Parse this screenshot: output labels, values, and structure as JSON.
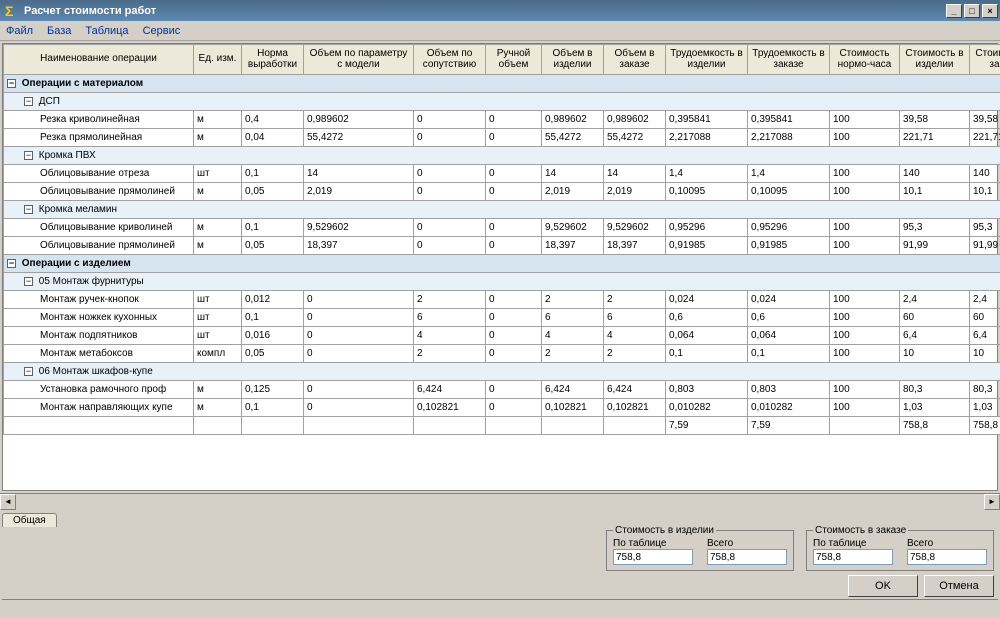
{
  "window": {
    "title": "Расчет стоимости работ"
  },
  "menu": {
    "file": "Файл",
    "base": "База",
    "table": "Таблица",
    "service": "Сервис"
  },
  "columns": [
    "Наименование операции",
    "Ед. изм.",
    "Норма выработки",
    "Объем по параметру с модели",
    "Объем по сопутствию",
    "Ручной объем",
    "Объем в изделии",
    "Объем в заказе",
    "Трудоемкость в изделии",
    "Трудоемкость в заказе",
    "Стоимость нормо-часа",
    "Стоимость в изделии",
    "Стоимость в заказе"
  ],
  "groups": [
    {
      "label": "Операции с материалом",
      "sub": [
        {
          "label": "ДСП",
          "rows": [
            {
              "name": "Резка криволинейная",
              "u": "м",
              "norm": "0,4",
              "p1": "0,989602",
              "p2": "0",
              "p3": "0",
              "v1": "0,989602",
              "v2": "0,989602",
              "t1": "0,395841",
              "t2": "0,395841",
              "c": "100",
              "s1": "39,58",
              "s2": "39,58"
            },
            {
              "name": "Резка прямолинейная",
              "u": "м",
              "norm": "0,04",
              "p1": "55,4272",
              "p2": "0",
              "p3": "0",
              "v1": "55,4272",
              "v2": "55,4272",
              "t1": "2,217088",
              "t2": "2,217088",
              "c": "100",
              "s1": "221,71",
              "s2": "221,71"
            }
          ]
        },
        {
          "label": "Кромка ПВХ",
          "rows": [
            {
              "name": "Облицовывание отреза",
              "u": "шт",
              "norm": "0,1",
              "p1": "14",
              "p2": "0",
              "p3": "0",
              "v1": "14",
              "v2": "14",
              "t1": "1,4",
              "t2": "1,4",
              "c": "100",
              "s1": "140",
              "s2": "140"
            },
            {
              "name": "Облицовывание прямолиней",
              "u": "м",
              "norm": "0,05",
              "p1": "2,019",
              "p2": "0",
              "p3": "0",
              "v1": "2,019",
              "v2": "2,019",
              "t1": "0,10095",
              "t2": "0,10095",
              "c": "100",
              "s1": "10,1",
              "s2": "10,1"
            }
          ]
        },
        {
          "label": "Кромка меламин",
          "rows": [
            {
              "name": "Облицовывание криволиней",
              "u": "м",
              "norm": "0,1",
              "p1": "9,529602",
              "p2": "0",
              "p3": "0",
              "v1": "9,529602",
              "v2": "9,529602",
              "t1": "0,95296",
              "t2": "0,95296",
              "c": "100",
              "s1": "95,3",
              "s2": "95,3"
            },
            {
              "name": "Облицовывание прямолиней",
              "u": "м",
              "norm": "0,05",
              "p1": "18,397",
              "p2": "0",
              "p3": "0",
              "v1": "18,397",
              "v2": "18,397",
              "t1": "0,91985",
              "t2": "0,91985",
              "c": "100",
              "s1": "91,99",
              "s2": "91,99"
            }
          ]
        }
      ]
    },
    {
      "label": "Операции с изделием",
      "sub": [
        {
          "label": "05 Монтаж фурнитуры",
          "rows": [
            {
              "name": "Монтаж ручек-кнопок",
              "u": "шт",
              "norm": "0,012",
              "p1": "0",
              "p2": "2",
              "p3": "0",
              "v1": "2",
              "v2": "2",
              "t1": "0,024",
              "t2": "0,024",
              "c": "100",
              "s1": "2,4",
              "s2": "2,4"
            },
            {
              "name": "Монтаж ножкек кухонных",
              "u": "шт",
              "norm": "0,1",
              "p1": "0",
              "p2": "6",
              "p3": "0",
              "v1": "6",
              "v2": "6",
              "t1": "0,6",
              "t2": "0,6",
              "c": "100",
              "s1": "60",
              "s2": "60"
            },
            {
              "name": "Монтаж подпятников",
              "u": "шт",
              "norm": "0,016",
              "p1": "0",
              "p2": "4",
              "p3": "0",
              "v1": "4",
              "v2": "4",
              "t1": "0,064",
              "t2": "0,064",
              "c": "100",
              "s1": "6,4",
              "s2": "6,4"
            },
            {
              "name": "Монтаж метабоксов",
              "u": "компл",
              "norm": "0,05",
              "p1": "0",
              "p2": "2",
              "p3": "0",
              "v1": "2",
              "v2": "2",
              "t1": "0,1",
              "t2": "0,1",
              "c": "100",
              "s1": "10",
              "s2": "10"
            }
          ]
        },
        {
          "label": "06 Монтаж шкафов-купе",
          "rows": [
            {
              "name": "Установка рамочного проф",
              "u": "м",
              "norm": "0,125",
              "p1": "0",
              "p2": "6,424",
              "p3": "0",
              "v1": "6,424",
              "v2": "6,424",
              "t1": "0,803",
              "t2": "0,803",
              "c": "100",
              "s1": "80,3",
              "s2": "80,3"
            },
            {
              "name": "Монтаж направляющих купе",
              "u": "м",
              "norm": "0,1",
              "p1": "0",
              "p2": "0,102821",
              "p3": "0",
              "v1": "0,102821",
              "v2": "0,102821",
              "t1": "0,010282",
              "t2": "0,010282",
              "c": "100",
              "s1": "1,03",
              "s2": "1,03"
            }
          ]
        }
      ]
    }
  ],
  "totals": {
    "t1": "7,59",
    "t2": "7,59",
    "s1": "758,8",
    "s2": "758,8"
  },
  "tab": {
    "label": "Общая"
  },
  "summary": {
    "item": {
      "title": "Стоимость в изделии",
      "byTableLabel": "По таблице",
      "totalLabel": "Всего",
      "byTable": "758,8",
      "total": "758,8"
    },
    "order": {
      "title": "Стоимость в заказе",
      "byTableLabel": "По таблице",
      "totalLabel": "Всего",
      "byTable": "758,8",
      "total": "758,8"
    }
  },
  "buttons": {
    "ok": "OK",
    "cancel": "Отмена"
  }
}
